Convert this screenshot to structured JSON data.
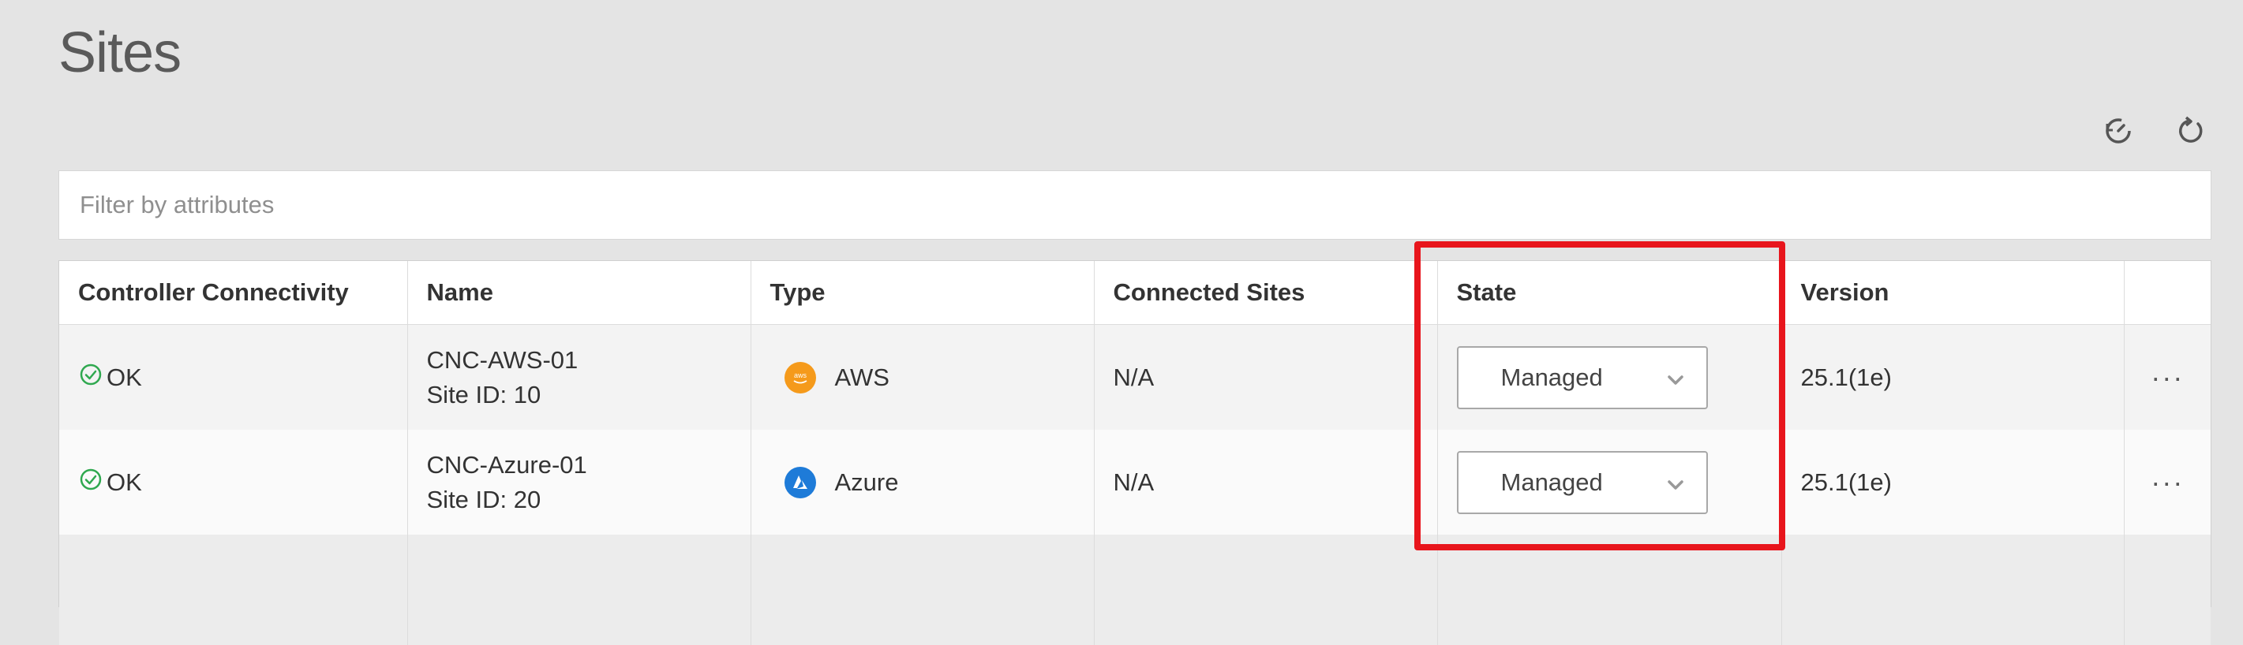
{
  "page": {
    "title": "Sites"
  },
  "filter": {
    "placeholder": "Filter by attributes"
  },
  "table": {
    "headers": [
      "Controller Connectivity",
      "Name",
      "Type",
      "Connected Sites",
      "State",
      "Version"
    ],
    "rows": [
      {
        "connectivity": "OK",
        "name": "CNC-AWS-01",
        "site_id": "Site ID: 10",
        "type": "AWS",
        "type_icon": "aws-logo-icon",
        "connected_sites": "N/A",
        "state": "Managed",
        "version": "25.1(1e)"
      },
      {
        "connectivity": "OK",
        "name": "CNC-Azure-01",
        "site_id": "Site ID: 20",
        "type": "Azure",
        "type_icon": "azure-logo-icon",
        "connected_sites": "N/A",
        "state": "Managed",
        "version": "25.1(1e)"
      }
    ]
  },
  "actions": {
    "more_label": "···"
  },
  "colors": {
    "ok_green": "#2fa84f",
    "highlight_red": "#e8151c",
    "aws_orange": "#f59a1b",
    "azure_blue": "#1e7bd8"
  }
}
